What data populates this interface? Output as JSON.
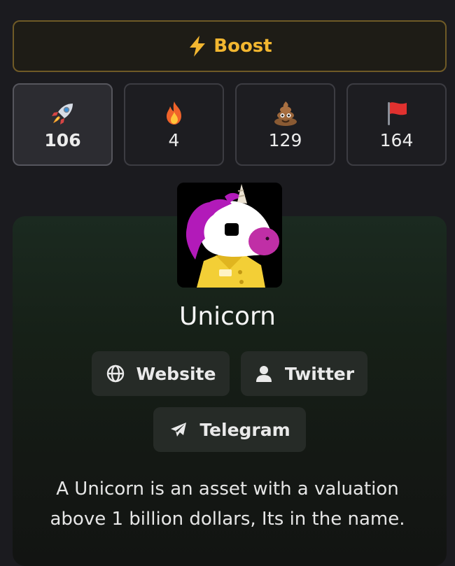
{
  "boost": {
    "label": "Boost",
    "icon": "lightning-bolt-icon",
    "color": "#f2b630"
  },
  "reactions": [
    {
      "icon": "rocket-icon",
      "count": "106",
      "active": true
    },
    {
      "icon": "fire-icon",
      "count": "4",
      "active": false
    },
    {
      "icon": "poop-icon",
      "count": "129",
      "active": false
    },
    {
      "icon": "red-flag-icon",
      "count": "164",
      "active": false
    }
  ],
  "token": {
    "name": "Unicorn",
    "avatar_icon": "unicorn-avatar-image",
    "description": "A Unicorn is an asset with a valuation above 1 billion dollars, Its in the name."
  },
  "links": {
    "website": {
      "label": "Website",
      "icon": "globe-icon"
    },
    "twitter": {
      "label": "Twitter",
      "icon": "user-icon"
    },
    "telegram": {
      "label": "Telegram",
      "icon": "paper-plane-icon"
    }
  }
}
